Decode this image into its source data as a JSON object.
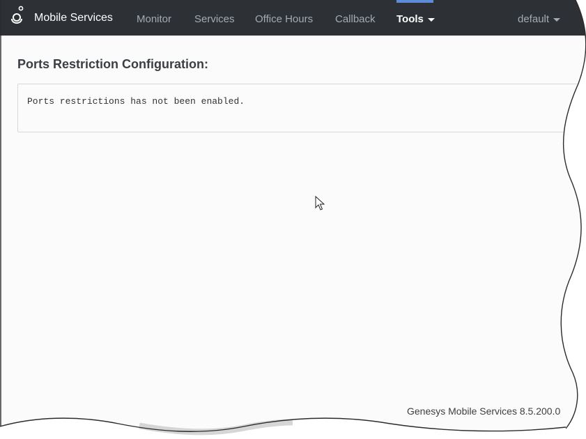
{
  "navbar": {
    "brand": "Mobile Services",
    "items": [
      {
        "label": "Monitor"
      },
      {
        "label": "Services"
      },
      {
        "label": "Office Hours"
      },
      {
        "label": "Callback"
      },
      {
        "label": "Tools"
      }
    ],
    "active_item": "Tools",
    "user_menu": "default"
  },
  "main": {
    "title": "Ports Restriction Configuration:",
    "message": "Ports restrictions has not been enabled."
  },
  "footer": {
    "version_text": "Genesys Mobile Services 8.5.200.0"
  },
  "icons": {
    "brand": "genesys-logo-icon",
    "dropdown": "caret-down-icon",
    "pointer": "mouse-cursor-icon"
  },
  "colors": {
    "navbar_bg": "#2d3136",
    "nav_text": "#a3aab2",
    "nav_active_text": "#ffffff",
    "active_indicator": "#5b8bd9",
    "title_text": "#3b3e42"
  }
}
